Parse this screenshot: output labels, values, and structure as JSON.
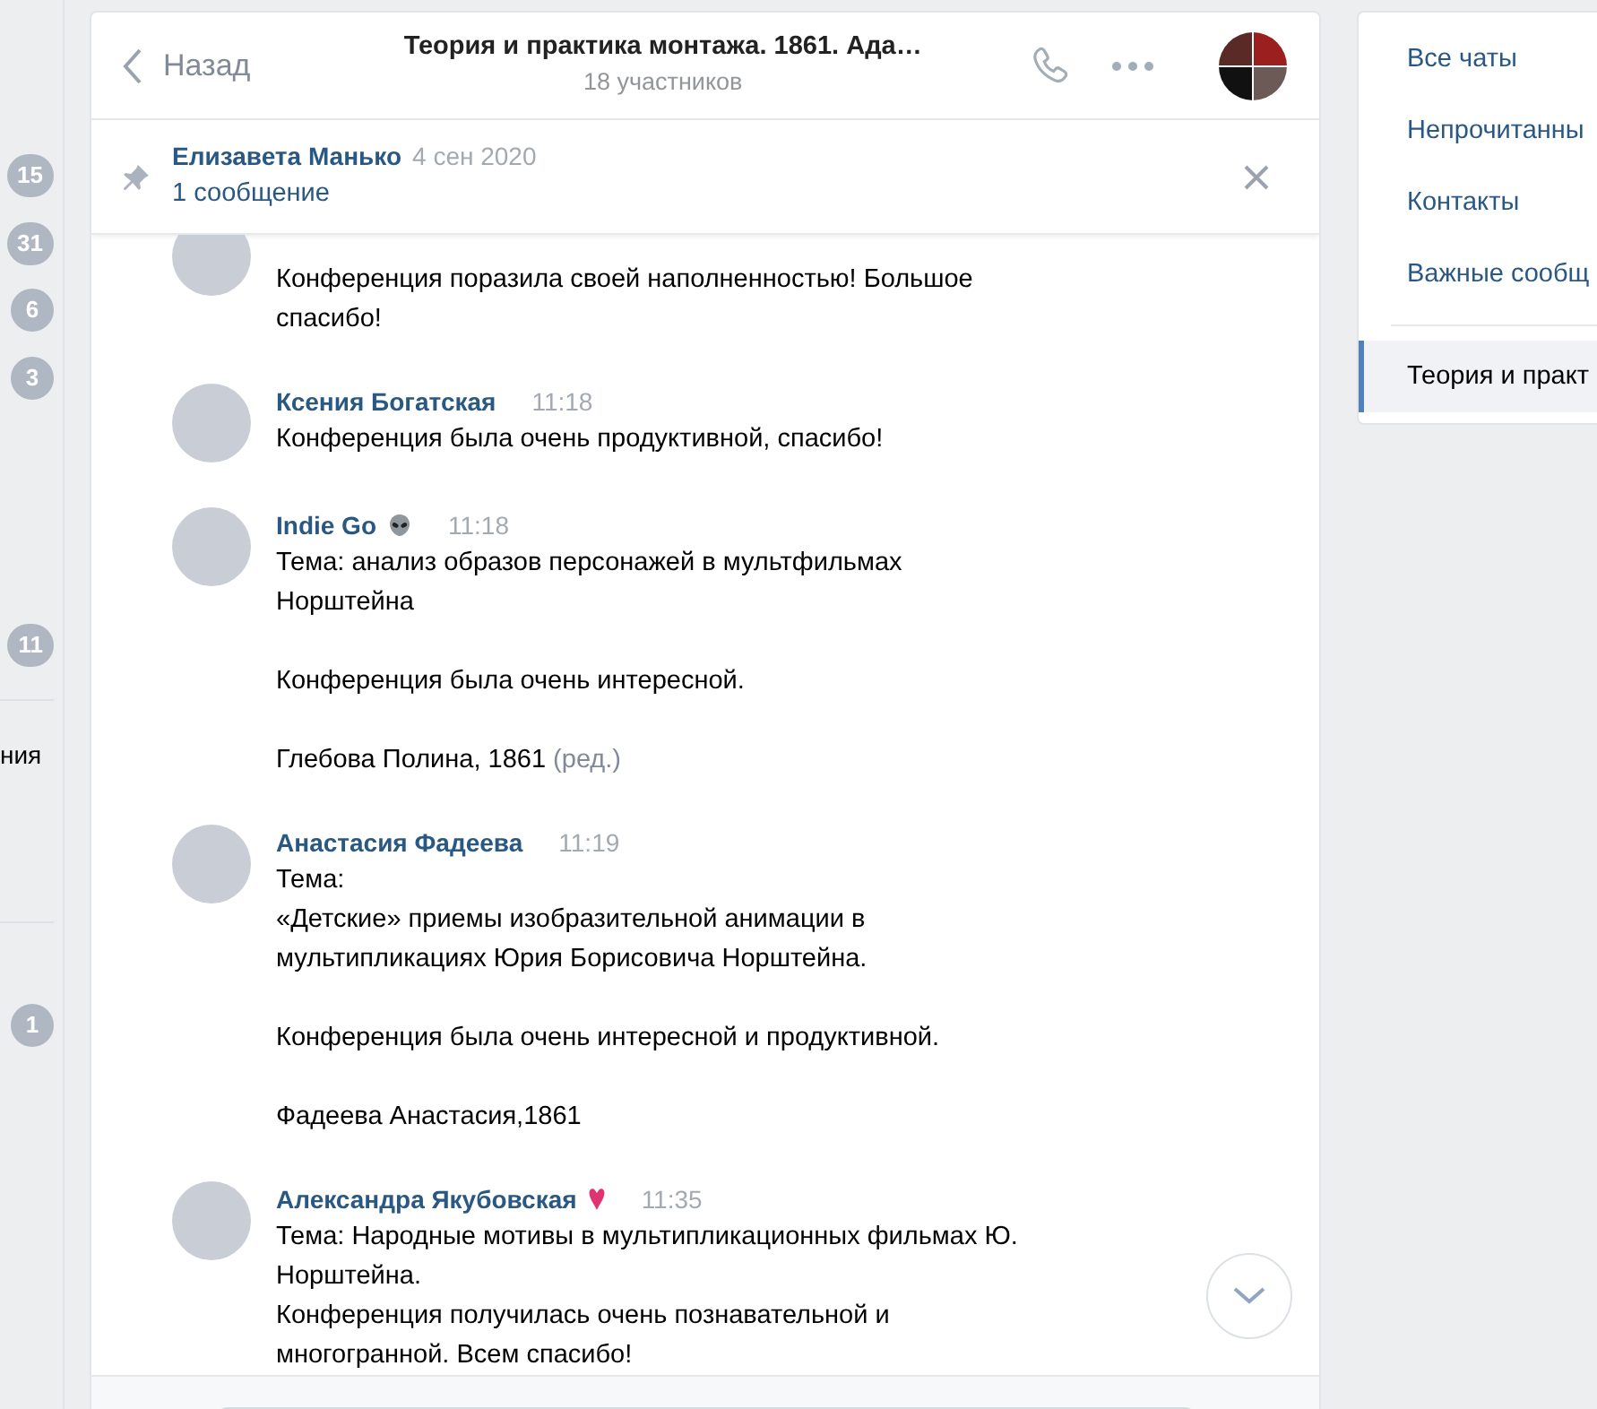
{
  "left_strip": {
    "items": [
      {
        "kind": "badge",
        "text": "15"
      },
      {
        "kind": "badge",
        "text": "31"
      },
      {
        "kind": "badge",
        "text": "6"
      },
      {
        "kind": "badge",
        "text": "3"
      },
      {
        "kind": "badge",
        "text": "11"
      },
      {
        "kind": "divider"
      },
      {
        "kind": "text",
        "text": "ния"
      },
      {
        "kind": "divider"
      },
      {
        "kind": "badge",
        "text": "1"
      }
    ]
  },
  "header": {
    "back": "Назад",
    "title": "Теория и практика монтажа. 1861. Ада…",
    "subtitle": "18 участников"
  },
  "pinned": {
    "author": "Елизавета Манько",
    "date": "4 сен 2020",
    "summary": "1 сообщение"
  },
  "messages": [
    {
      "kind": "continued",
      "text": "Конференция поразила своей наполненностью! Большое\nспасибо!"
    },
    {
      "kind": "plain",
      "author": "Ксения Богатская",
      "time": "11:18",
      "text": "Конференция была очень продуктивной, спасибо!"
    },
    {
      "kind": "alien",
      "author": "Indie Go",
      "time": "11:18",
      "text": "Тема: анализ образов персонажей в мультфильмах\nНорштейна\n\nКонференция была очень интересной.\n\nГлебова Полина, 1861",
      "edited": "(ред.)"
    },
    {
      "kind": "plain",
      "author": "Анастасия Фадеева",
      "time": "11:19",
      "text": "Тема:\n«Детские» приемы изобразительной анимации в\nмультипликациях Юрия Борисовича Норштейна.\n\nКонференция была очень интересной и продуктивной.\n\nФадеева Анастасия,1861"
    },
    {
      "kind": "heart",
      "author": "Александра Якубовская",
      "time": "11:35",
      "text": "Тема: Народные мотивы в мультипликационных фильмах Ю.\nНорштейна.\nКонференция получилась очень познавательной и\nмногогранной. Всем спасибо!"
    }
  ],
  "right_menu": {
    "items": [
      {
        "label": "Все чаты",
        "selected": false
      },
      {
        "label": "Непрочитанны",
        "selected": false
      },
      {
        "label": "Контакты",
        "selected": false
      },
      {
        "label": "Важные сообщ",
        "selected": false
      },
      {
        "label": "Теория и практ",
        "selected": true
      }
    ]
  }
}
